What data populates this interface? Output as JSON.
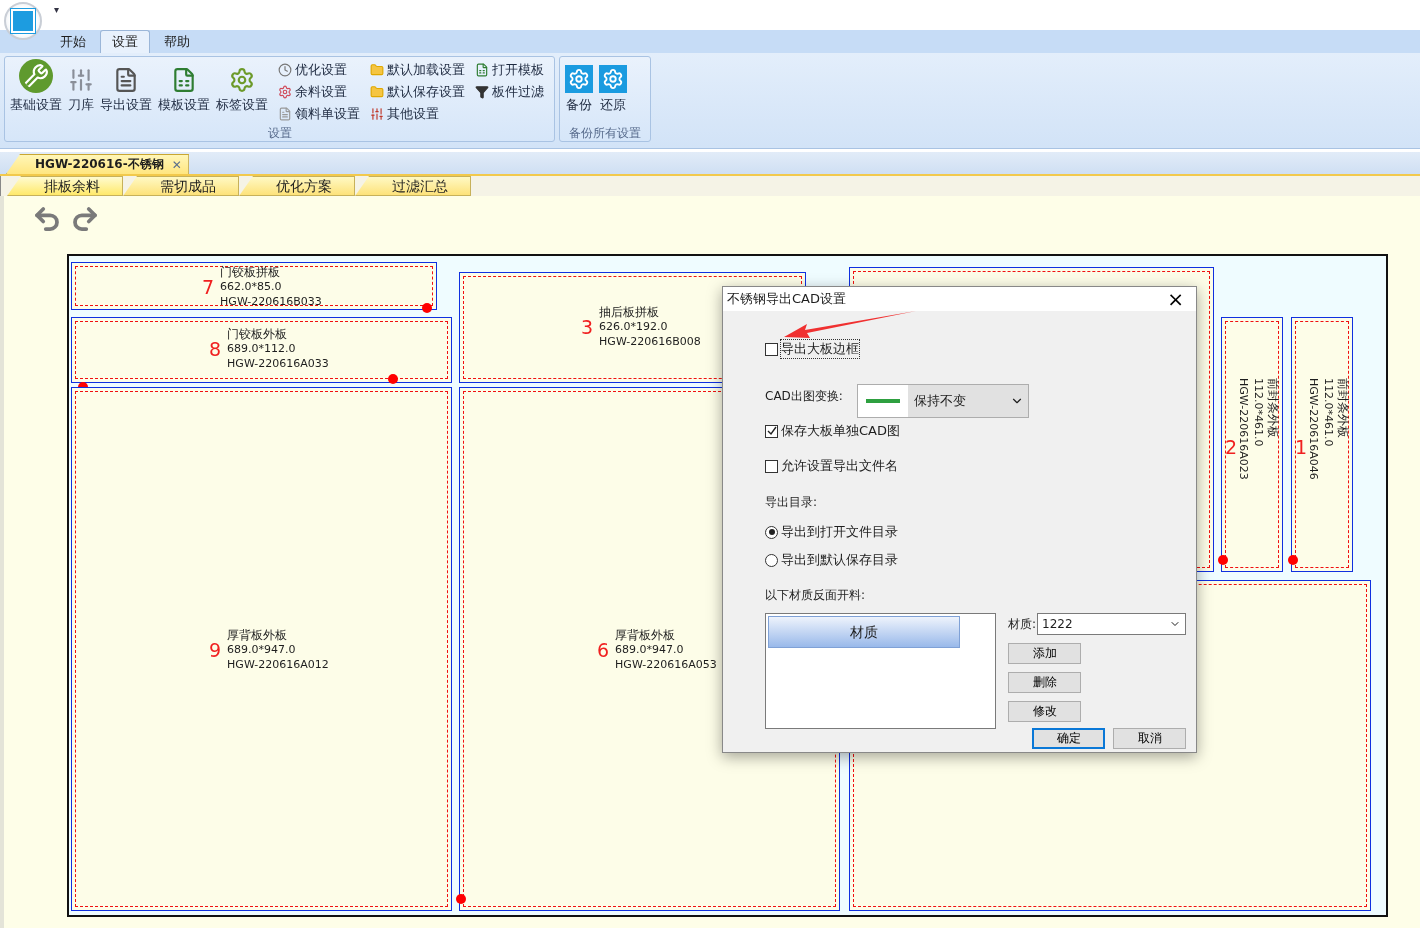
{
  "quick_access": {
    "caret": "▾"
  },
  "ribbon": {
    "tabs": [
      {
        "label": "开始",
        "selected": false
      },
      {
        "label": "设置",
        "selected": true
      },
      {
        "label": "帮助",
        "selected": false
      }
    ],
    "groups": [
      {
        "title": "设置",
        "large_buttons": [
          {
            "label": "基础设置",
            "kind": "tools"
          },
          {
            "label": "刀库",
            "kind": "knife"
          },
          {
            "label": "导出设置",
            "kind": "export"
          },
          {
            "label": "模板设置",
            "kind": "template"
          },
          {
            "label": "标签设置",
            "kind": "label"
          }
        ],
        "small_columns": [
          [
            {
              "label": "优化设置",
              "kind": "clock"
            },
            {
              "label": "余料设置",
              "kind": "remnant"
            },
            {
              "label": "领料单设置",
              "kind": "page"
            }
          ],
          [
            {
              "label": "默认加载设置",
              "kind": "folder-load"
            },
            {
              "label": "默认保存设置",
              "kind": "folder-save"
            },
            {
              "label": "其他设置",
              "kind": "sliders"
            }
          ],
          [
            {
              "label": "打开模板",
              "kind": "sheet"
            },
            {
              "label": "板件过滤",
              "kind": "filter"
            }
          ]
        ]
      },
      {
        "title": "备份所有设置",
        "large_buttons": [
          {
            "label": "备份",
            "kind": "backup"
          },
          {
            "label": "还原",
            "kind": "restore"
          }
        ]
      }
    ]
  },
  "document_tabs": [
    {
      "label": "HGW-220616-不锈钢",
      "selected": true,
      "close": "✕"
    }
  ],
  "view_tabs": [
    {
      "label": "排板余料",
      "selected": true
    },
    {
      "label": "需切成品",
      "selected": false
    },
    {
      "label": "优化方案",
      "selected": false
    },
    {
      "label": "过滤汇总",
      "selected": false
    }
  ],
  "board": {
    "parts": [
      {
        "number": "7",
        "name": "门铰板拼板",
        "size": "662.0*85.0",
        "code": "HGW-220616B033",
        "kind": "horizontal"
      },
      {
        "number": "8",
        "name": "门铰板外板",
        "size": "689.0*112.0",
        "code": "HGW-220616A033",
        "kind": "horizontal"
      },
      {
        "number": "3",
        "name": "抽后板拼板",
        "size": "626.0*192.0",
        "code": "HGW-220616B008",
        "kind": "horizontal"
      },
      {
        "number": "9",
        "name": "厚背板外板",
        "size": "689.0*947.0",
        "code": "HGW-220616A012",
        "kind": "horizontal"
      },
      {
        "number": "6",
        "name": "厚背板外板",
        "size": "689.0*947.0",
        "code": "HGW-220616A053",
        "kind": "horizontal"
      },
      {
        "number": "2",
        "name": "前封条外板",
        "size": "112.0*461.0",
        "code": "HGW-220616A023",
        "kind": "vertical"
      },
      {
        "number": "1",
        "name": "前封条外板",
        "size": "112.0*461.0",
        "code": "HGW-220616A046",
        "kind": "vertical"
      }
    ]
  },
  "dialog": {
    "title": "不锈钢导出CAD设置",
    "close": "×",
    "export_border": {
      "label": "导出大板边框",
      "checked": false
    },
    "transform": {
      "label": "CAD出图变换:",
      "value": "保持不变"
    },
    "save_single": {
      "label": "保存大板单独CAD图",
      "checked": true
    },
    "allow_rename": {
      "label": "允许设置导出文件名",
      "checked": false
    },
    "directory_label": "导出目录:",
    "directories": [
      {
        "label": "导出到打开文件目录",
        "selected": true
      },
      {
        "label": "导出到默认保存目录",
        "selected": false
      }
    ],
    "reverse_label": "以下材质反面开料:",
    "material_list": {
      "column": "材质"
    },
    "material": {
      "label": "材质:",
      "value": "1222"
    },
    "side_buttons": [
      "添加",
      "删除",
      "修改"
    ],
    "ok": "确定",
    "cancel": "取消"
  }
}
